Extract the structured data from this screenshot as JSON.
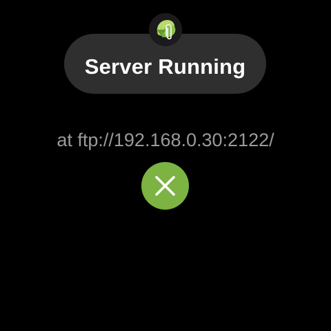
{
  "app": {
    "icon": "ftp-server-clip-icon",
    "icon_colors": {
      "background": "#1c1a1c",
      "leaf_light": "#b8dc6a",
      "leaf_dark": "#5f9a32",
      "clip": "#f2f2f2"
    }
  },
  "status": {
    "title": "Server Running",
    "address": "at ftp://192.168.0.30:2122/"
  },
  "actions": {
    "stop": {
      "icon": "close-icon",
      "color": "#7cb342"
    }
  },
  "theme": {
    "background": "#000000",
    "chip": "#2f2f2f",
    "title_text": "#ffffff",
    "secondary_text": "#9a9a9a"
  }
}
